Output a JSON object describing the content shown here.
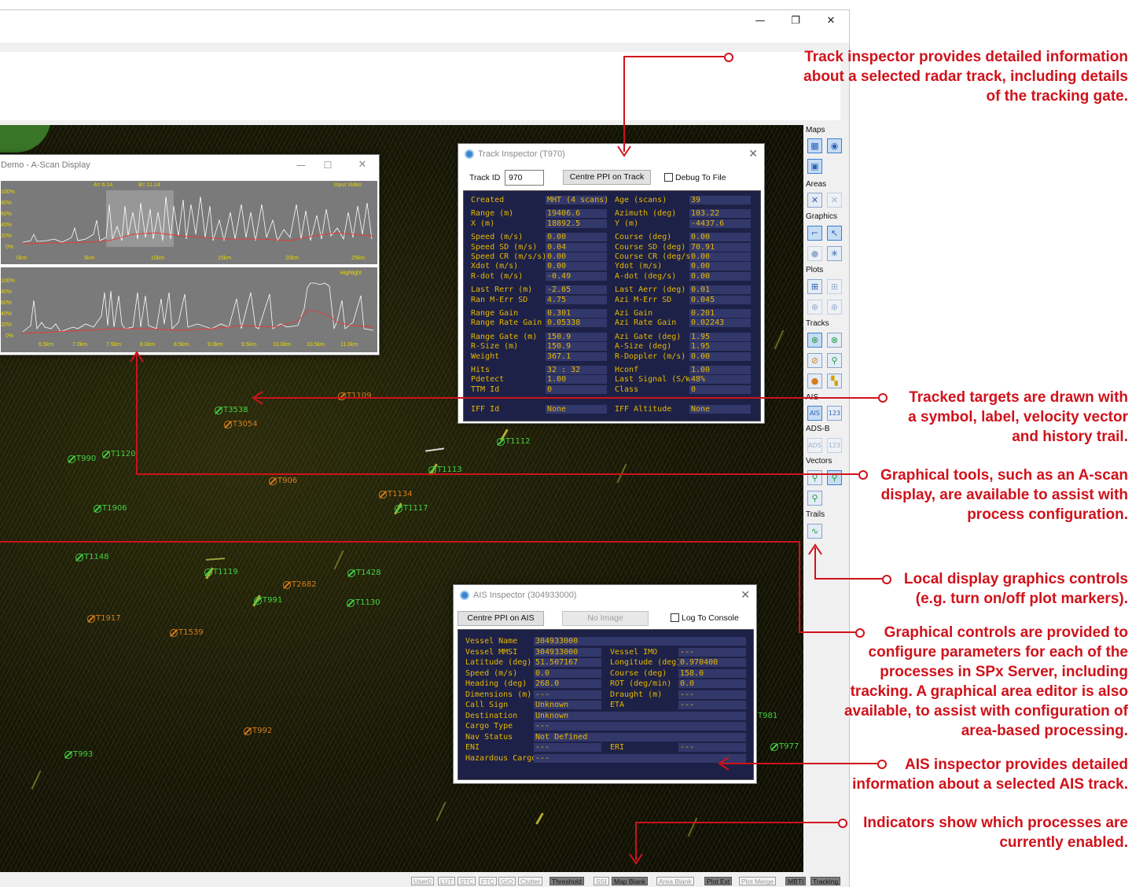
{
  "window": {
    "minimize_glyph": "—",
    "restore_glyph": "❐",
    "close_glyph": "✕"
  },
  "tracks": [
    {
      "label": "T3538",
      "color": "green"
    },
    {
      "label": "T3054",
      "color": "orange"
    },
    {
      "label": "T1109",
      "color": "orange"
    },
    {
      "label": "T1112",
      "color": "green"
    },
    {
      "label": "T990",
      "color": "green"
    },
    {
      "label": "T1120",
      "color": "green"
    },
    {
      "label": "T1113",
      "color": "green"
    },
    {
      "label": "T906",
      "color": "orange"
    },
    {
      "label": "T1134",
      "color": "orange"
    },
    {
      "label": "T1117",
      "color": "green"
    },
    {
      "label": "T1906",
      "color": "green"
    },
    {
      "label": "T1148",
      "color": "green"
    },
    {
      "label": "T1119",
      "color": "green"
    },
    {
      "label": "T1428",
      "color": "green"
    },
    {
      "label": "T2682",
      "color": "orange"
    },
    {
      "label": "T991",
      "color": "green"
    },
    {
      "label": "T1130",
      "color": "green"
    },
    {
      "label": "T1917",
      "color": "orange"
    },
    {
      "label": "T1539",
      "color": "orange"
    },
    {
      "label": "T992",
      "color": "orange"
    },
    {
      "label": "T993",
      "color": "green"
    },
    {
      "label": "T981",
      "color": "green"
    },
    {
      "label": "T977",
      "color": "green"
    }
  ],
  "ascan": {
    "title": "Demo - A-Scan Display",
    "top_panel": {
      "cursor_a": "A= 6.14",
      "cursor_b": "B= 11.14",
      "corner_label": "Input Video",
      "y_ticks": [
        "100%",
        "80%",
        "60%",
        "40%",
        "20%",
        "0%"
      ],
      "x_ticks": [
        "0km",
        "5km",
        "10km",
        "15km",
        "20km",
        "25km"
      ]
    },
    "bottom_panel": {
      "corner_label": "Highlight",
      "y_ticks": [
        "100%",
        "80%",
        "60%",
        "40%",
        "20%",
        "0%"
      ],
      "x_ticks": [
        "6.5km",
        "7.0km",
        "7.5km",
        "8.0km",
        "8.5km",
        "9.0km",
        "9.5km",
        "10.0km",
        "10.5km",
        "11.0km"
      ]
    }
  },
  "track_inspector": {
    "title": "Track Inspector (T970)",
    "track_id_label": "Track ID",
    "track_id_value": "970",
    "centre_button": "Centre PPI on Track",
    "debug_checkbox": "Debug To File",
    "rows": [
      {
        "l1": "Created",
        "v1": "MHT (4 scans)",
        "l2": "Age (scans)",
        "v2": "39"
      },
      {
        "l1": "Range (m)",
        "v1": "19406.6",
        "l2": "Azimuth (deg)",
        "v2": "103.22"
      },
      {
        "l1": "X (m)",
        "v1": "18892.5",
        "l2": "Y (m)",
        "v2": "-4437.6"
      },
      {
        "l1": "Speed (m/s)",
        "v1": "0.00",
        "l2": "Course (deg)",
        "v2": "0.00"
      },
      {
        "l1": "Speed SD (m/s)",
        "v1": "0.04",
        "l2": "Course SD (deg)",
        "v2": "70.91"
      },
      {
        "l1": "Speed CR (m/s/s)",
        "v1": "0.00",
        "l2": "Course CR (deg/s)",
        "v2": "0.00"
      },
      {
        "l1": "Xdot (m/s)",
        "v1": "0.00",
        "l2": "Ydot (m/s)",
        "v2": "0.00"
      },
      {
        "l1": "R-dot (m/s)",
        "v1": "-0.49",
        "l2": "A-dot (deg/s)",
        "v2": "0.00"
      },
      {
        "l1": "Last Rerr (m)",
        "v1": "-2.05",
        "l2": "Last Aerr (deg)",
        "v2": "0.01"
      },
      {
        "l1": "Ran M-Err SD",
        "v1": "4.75",
        "l2": "Azi M-Err SD",
        "v2": "0.045"
      },
      {
        "l1": "Range Gain",
        "v1": "0.301",
        "l2": "Azi Gain",
        "v2": "0.201"
      },
      {
        "l1": "Range Rate Gain",
        "v1": "0.05338",
        "l2": "Azi Rate Gain",
        "v2": "0.02243"
      },
      {
        "l1": "Range Gate (m)",
        "v1": "150.9",
        "l2": "Azi Gate (deg)",
        "v2": "1.95"
      },
      {
        "l1": "R-Size (m)",
        "v1": "150.9",
        "l2": "A-Size (deg)",
        "v2": "1.95"
      },
      {
        "l1": "Weight",
        "v1": "367.1",
        "l2": "R-Doppler (m/s)",
        "v2": "0.00"
      },
      {
        "l1": "Hits",
        "v1": "32 : 32",
        "l2": "Hconf",
        "v2": "1.00"
      },
      {
        "l1": "Pdetect",
        "v1": "1.00",
        "l2": "Last Signal (S/W)",
        "v2": "48%"
      },
      {
        "l1": "TTM Id",
        "v1": "0",
        "l2": "Class",
        "v2": "0"
      },
      {
        "l1": "IFF Id",
        "v1": "None",
        "l2": "IFF Altitude",
        "v2": "None"
      }
    ]
  },
  "ais_inspector": {
    "title": "AIS Inspector (304933000)",
    "centre_button": "Centre PPI on AIS",
    "no_image_button": "No Image",
    "log_checkbox": "Log To Console",
    "rows": [
      {
        "l1": "Vessel Name",
        "v1": "304933000"
      },
      {
        "l1": "Vessel MMSI",
        "v1": "304933000",
        "l2": "Vessel IMO",
        "v2": "---"
      },
      {
        "l1": "Latitude (deg)",
        "v1": "51.507167",
        "l2": "Longitude (deg)",
        "v2": "0.970400"
      },
      {
        "l1": "Speed (m/s)",
        "v1": "0.0",
        "l2": "Course (deg)",
        "v2": "158.0"
      },
      {
        "l1": "Heading (deg)",
        "v1": "268.0",
        "l2": "ROT (deg/min)",
        "v2": "0.0"
      },
      {
        "l1": "Dimensions (m)",
        "v1": "---",
        "l2": "Draught (m)",
        "v2": "---"
      },
      {
        "l1": "Call Sign",
        "v1": "Unknown",
        "l2": "ETA",
        "v2": "---"
      },
      {
        "l1": "Destination",
        "v1": "Unknown"
      },
      {
        "l1": "Cargo Type",
        "v1": "---"
      },
      {
        "l1": "Nav Status",
        "v1": "Not Defined"
      },
      {
        "l1": "ENI",
        "v1": "---",
        "l2": "ERI",
        "v2": "---"
      },
      {
        "l1": "Hazardous Cargo",
        "v1": "---"
      }
    ]
  },
  "toolbar": {
    "sections": [
      "Maps",
      "Areas",
      "Graphics",
      "Plots",
      "Tracks",
      "AIS",
      "ADS-B",
      "Vectors",
      "Trails"
    ]
  },
  "status_indicators": [
    {
      "label": "User0",
      "on": false
    },
    {
      "label": "LUT",
      "on": false
    },
    {
      "label": "STC",
      "on": false
    },
    {
      "label": "FTC",
      "on": false
    },
    {
      "label": "G/O",
      "on": false
    },
    {
      "label": "Clutter",
      "on": false
    },
    {
      "label": "Threshold",
      "on": true
    },
    {
      "label": "SSI",
      "on": false
    },
    {
      "label": "Map Blank",
      "on": true
    },
    {
      "label": "Area Blank",
      "on": false
    },
    {
      "label": "Plot Ext",
      "on": true
    },
    {
      "label": "Plot Merge",
      "on": false
    },
    {
      "label": "MBTI",
      "on": true
    },
    {
      "label": "Tracking",
      "on": true
    }
  ],
  "annotations": [
    {
      "lines": [
        "Track inspector provides detailed information",
        "about a selected radar track, including details",
        "of the tracking gate."
      ]
    },
    {
      "lines": [
        "Tracked targets are drawn with",
        "a symbol, label, velocity vector",
        "and history trail."
      ]
    },
    {
      "lines": [
        "Graphical tools, such as an A-scan",
        "display, are available to assist with",
        "process configuration."
      ]
    },
    {
      "lines": [
        "Local display graphics controls",
        "(e.g. turn on/off plot markers)."
      ]
    },
    {
      "lines": [
        "Graphical controls are provided to",
        "configure parameters for each of the",
        "processes in SPx Server, including",
        "tracking.  A graphical area editor is also",
        "available, to assist with configuration of",
        "area-based processing."
      ]
    },
    {
      "lines": [
        "AIS inspector provides detailed",
        "information about a selected AIS track."
      ]
    },
    {
      "lines": [
        "Indicators show which processes are",
        "currently enabled."
      ]
    }
  ],
  "colors": {
    "annotation": "#d0121b",
    "track_green": "#43d143",
    "track_orange": "#d67d1e",
    "inspector_bg": "#1e2147",
    "inspector_text": "#e6b800"
  }
}
